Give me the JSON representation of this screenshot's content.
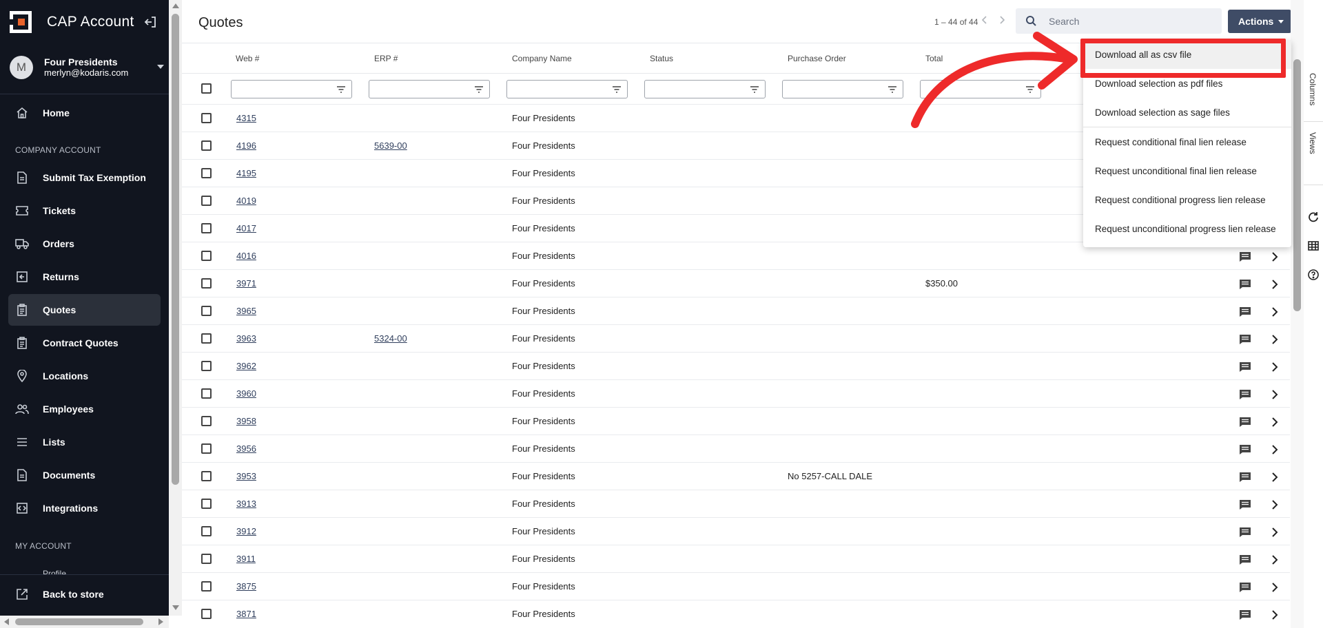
{
  "app": {
    "title": "CAP Account",
    "user_name": "Four Presidents",
    "user_email": "merlyn@kodaris.com",
    "avatar_letter": "M"
  },
  "sidebar": {
    "items": [
      {
        "label": "Home",
        "icon": "home-icon"
      },
      {
        "label": "Submit Tax Exemption",
        "icon": "document-icon"
      },
      {
        "label": "Tickets",
        "icon": "ticket-icon"
      },
      {
        "label": "Orders",
        "icon": "truck-icon"
      },
      {
        "label": "Returns",
        "icon": "return-icon"
      },
      {
        "label": "Quotes",
        "icon": "clipboard-icon"
      },
      {
        "label": "Contract Quotes",
        "icon": "clipboard-icon"
      },
      {
        "label": "Locations",
        "icon": "location-pin-icon"
      },
      {
        "label": "Employees",
        "icon": "people-icon"
      },
      {
        "label": "Lists",
        "icon": "list-icon"
      },
      {
        "label": "Documents",
        "icon": "document-icon"
      },
      {
        "label": "Integrations",
        "icon": "integration-icon"
      }
    ],
    "section_company": "COMPANY ACCOUNT",
    "section_my": "MY ACCOUNT",
    "partial_item": "Profile",
    "back_to_store": "Back to store"
  },
  "header": {
    "title": "Quotes",
    "pager": "1 – 44 of 44",
    "search_placeholder": "Search",
    "actions_label": "Actions"
  },
  "table": {
    "columns": [
      "Web #",
      "ERP #",
      "Company Name",
      "Status",
      "Purchase Order",
      "Total"
    ],
    "rows": [
      {
        "web": "4315",
        "erp": "",
        "company": "Four Presidents",
        "status": "",
        "po": "",
        "total": ""
      },
      {
        "web": "4196",
        "erp": "5639-00",
        "company": "Four Presidents",
        "status": "",
        "po": "",
        "total": ""
      },
      {
        "web": "4195",
        "erp": "",
        "company": "Four Presidents",
        "status": "",
        "po": "",
        "total": ""
      },
      {
        "web": "4019",
        "erp": "",
        "company": "Four Presidents",
        "status": "",
        "po": "",
        "total": ""
      },
      {
        "web": "4017",
        "erp": "",
        "company": "Four Presidents",
        "status": "",
        "po": "",
        "total": ""
      },
      {
        "web": "4016",
        "erp": "",
        "company": "Four Presidents",
        "status": "",
        "po": "",
        "total": ""
      },
      {
        "web": "3971",
        "erp": "",
        "company": "Four Presidents",
        "status": "",
        "po": "",
        "total": "$350.00"
      },
      {
        "web": "3965",
        "erp": "",
        "company": "Four Presidents",
        "status": "",
        "po": "",
        "total": ""
      },
      {
        "web": "3963",
        "erp": "5324-00",
        "company": "Four Presidents",
        "status": "",
        "po": "",
        "total": ""
      },
      {
        "web": "3962",
        "erp": "",
        "company": "Four Presidents",
        "status": "",
        "po": "",
        "total": ""
      },
      {
        "web": "3960",
        "erp": "",
        "company": "Four Presidents",
        "status": "",
        "po": "",
        "total": ""
      },
      {
        "web": "3958",
        "erp": "",
        "company": "Four Presidents",
        "status": "",
        "po": "",
        "total": ""
      },
      {
        "web": "3956",
        "erp": "",
        "company": "Four Presidents",
        "status": "",
        "po": "",
        "total": ""
      },
      {
        "web": "3953",
        "erp": "",
        "company": "Four Presidents",
        "status": "",
        "po": "No 5257-CALL DALE",
        "total": ""
      },
      {
        "web": "3913",
        "erp": "",
        "company": "Four Presidents",
        "status": "",
        "po": "",
        "total": ""
      },
      {
        "web": "3912",
        "erp": "",
        "company": "Four Presidents",
        "status": "",
        "po": "",
        "total": ""
      },
      {
        "web": "3911",
        "erp": "",
        "company": "Four Presidents",
        "status": "",
        "po": "",
        "total": ""
      },
      {
        "web": "3875",
        "erp": "",
        "company": "Four Presidents",
        "status": "",
        "po": "",
        "total": ""
      },
      {
        "web": "3871",
        "erp": "",
        "company": "Four Presidents",
        "status": "",
        "po": "",
        "total": ""
      }
    ]
  },
  "actions_menu": {
    "items": [
      "Download all as csv file",
      "Download selection as pdf files",
      "Download selection as sage files",
      "Request conditional final lien release",
      "Request unconditional final lien release",
      "Request conditional progress lien release",
      "Request unconditional progress lien release"
    ]
  },
  "rail": {
    "columns_label": "Columns",
    "views_label": "Views"
  },
  "colors": {
    "sidebar_bg": "#11151f",
    "actions_button": "#3f4c66",
    "annotation_red": "#ee2a2a",
    "link": "#2f3e5c"
  }
}
